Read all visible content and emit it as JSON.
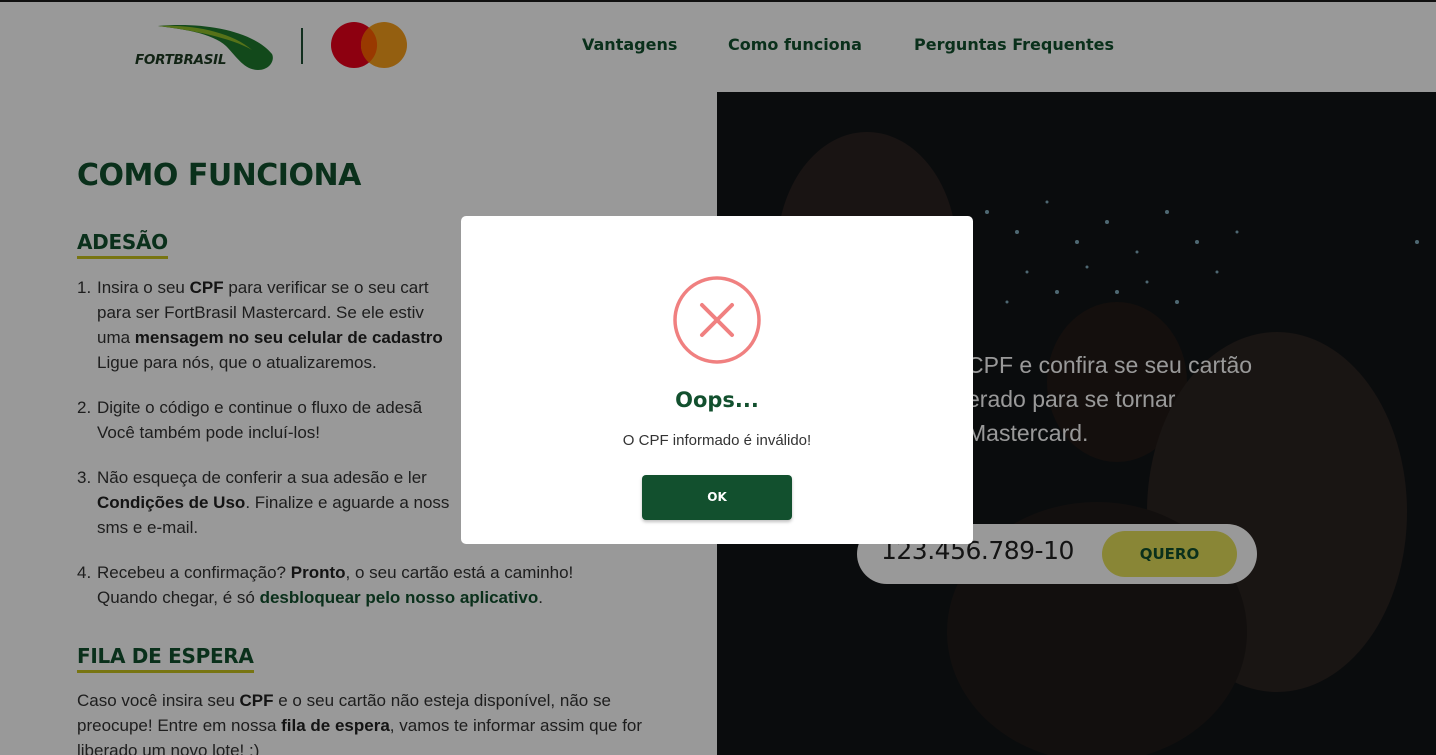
{
  "header": {
    "logo_text": "FORTBRASIL",
    "nav": [
      "Vantagens",
      "Como funciona",
      "Perguntas Frequentes"
    ]
  },
  "main": {
    "title": "COMO FUNCIONA",
    "section1_title": "ADESÃO",
    "steps": [
      {
        "num": "1.",
        "parts": [
          "Insira o seu ",
          "CPF",
          " para verificar se o seu cart",
          "para ser FortBrasil Mastercard. Se ele estiv",
          "uma ",
          "mensagem no seu celular de cadastro",
          "Ligue para nós, que o atualizaremos."
        ]
      },
      {
        "num": "2.",
        "parts": [
          "Digite o código e continue o fluxo de adesã",
          "Você também pode incluí-los!"
        ]
      },
      {
        "num": "3.",
        "parts": [
          "Não esqueça de conferir a sua adesão e ler",
          "Condições de Uso",
          ". Finalize e aguarde a noss",
          "sms e e-mail."
        ]
      },
      {
        "num": "4.",
        "parts": [
          "Recebeu a confirmação? ",
          "Pronto",
          ", o seu cartão está a caminho!",
          "Quando chegar, é só ",
          "desbloquear pelo nosso aplicativo",
          "."
        ]
      }
    ],
    "section2_title": "FILA DE ESPERA",
    "fila_parts": [
      "Caso você insira seu ",
      "CPF",
      " e o seu cartão não esteja disponível, não se preocupe! Entre em nossa ",
      "fila de espera",
      ", vamos te informar assim que for liberado um novo lote! :)"
    ]
  },
  "hero": {
    "text": "CPF e confira se seu cartão\nerado para se tornar\nMastercard.",
    "cpf_value": "123.456.789-10",
    "button_label": "QUERO"
  },
  "modal": {
    "title": "Oops...",
    "message": "O CPF informado é inválido!",
    "ok_label": "OK",
    "icon": "error-x-icon",
    "icon_color": "#f08080"
  },
  "colors": {
    "brand_green": "#12502e",
    "accent_yellow": "#e4e05a",
    "mc_red": "#eb001b",
    "mc_orange": "#f79e1b"
  }
}
